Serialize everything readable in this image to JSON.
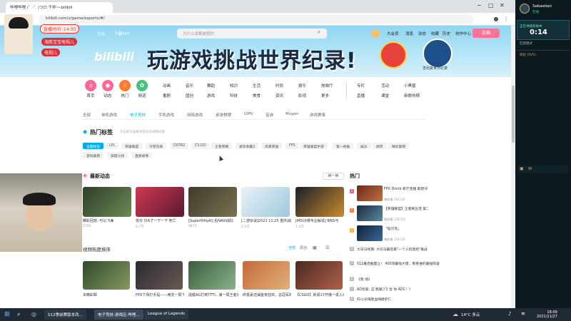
{
  "browser": {
    "tabs": [
      "哔哩哔哩 (゜-゜)つロ 干杯~-bilibili"
    ],
    "url": "bilibili.com/v/game/esports/#/"
  },
  "header": {
    "nav": [
      "主站",
      "番剧",
      "游戏中心",
      "直播",
      "会员购",
      "漫画",
      "赛事",
      "下载APP"
    ],
    "search_placeholder": "为什么说都是假的",
    "right_links": [
      "大会员",
      "消息",
      "动态",
      "收藏",
      "历史",
      "创作中心"
    ],
    "upload": "投稿"
  },
  "banner": {
    "title": "玩游戏挑战世界纪录!",
    "badge_label": "吉尼斯世界纪录"
  },
  "categories": [
    {
      "label": "首页",
      "color": "#ff6699"
    },
    {
      "label": "动态",
      "color": "#ff6699"
    },
    {
      "label": "热门",
      "color": "#ff7a2f"
    },
    {
      "label": "频道",
      "color": "#42c37c"
    }
  ],
  "subnav": [
    [
      "动画",
      "音乐",
      "舞蹈",
      "知识",
      "生活",
      "时尚",
      "娱乐",
      "放映厅"
    ],
    [
      "番剧",
      "国创",
      "游戏",
      "科技",
      "美食",
      "资讯",
      "影视",
      "更多"
    ]
  ],
  "extras": [
    "专栏",
    "活动",
    "小黑屋",
    "直播",
    "课堂",
    "新歌热榜"
  ],
  "subtabs": [
    "全部",
    "单机游戏",
    "电子竞技",
    "手机游戏",
    "网络游戏",
    "桌游棋牌",
    "GMV",
    "音游",
    "Mugen",
    "游戏赛事"
  ],
  "hot_tags": {
    "title": "热门标签",
    "subtitle": "点击即可查看本区标签视频内容",
    "tags": [
      "全部标签",
      "LPL",
      "英雄联盟",
      "守望先锋",
      "DOTA2",
      "CS:GO",
      "王者荣耀",
      "星际争霸2",
      "风暴英雄",
      "FPS",
      "英雄联盟手游",
      "第一视角",
      "娱乐",
      "搞笑",
      "精彩集锦",
      "游戏集锦",
      "穿越火线",
      "直播录像"
    ]
  },
  "dynamic": {
    "title": "最新动态",
    "refresh": "换一换"
  },
  "videos": [
    {
      "title": "精彩回放: 可以飞兼",
      "views": "1792"
    },
    {
      "title": "低价 只A了一下一下 死亡",
      "views": "6.7万"
    },
    {
      "title": "[SuperHifiyAI] 后NAVI战队",
      "views": "9475"
    },
    {
      "title": "[二游杂谈]2021 11.25 重庆战队",
      "views": "1.5万"
    },
    {
      "title": "[MSI决赛专业解说] RNG与",
      "views": "1.4万"
    }
  ],
  "ranking": {
    "title": "视频热度排序",
    "filters": [
      "全部",
      "原创"
    ]
  },
  "videos2": [
    {
      "title": "本精彩瞬"
    },
    {
      "title": "FPX下场打手是——两支一局\"统一局\""
    },
    {
      "title": "成都AG打到TTTI…第一局王者对抗"
    },
    {
      "title": "终极豪迈抽金夜狂欢，总冠军的最强阵容卡"
    },
    {
      "title": "【CSGO】新闻17开播一发入魂"
    }
  ],
  "hot": {
    "title": "热门",
    "items": [
      {
        "title": "FPX Doinb 新厅连播 斯嗯仔老乐乐 搞笑单一起瞎玩",
        "meta": "播放量 192.6万"
      },
      {
        "title": "【英雄联盟】王者刷五连 第二季收播回顾",
        "meta": "播放量 126.5万"
      },
      {
        "title": "「耻贝克」",
        "meta": "播放量 114.6万"
      }
    ],
    "list": [
      "大司马经典: 大司马最后暴\"一个人的连招\"再战",
      "S11最佳截图之！ 400场最强大佬，看看谁的最强阵容",
      "《我 他》",
      "AD玩家: 这 我输了3 合 你 ADC！？",
      "IG小乐嗨放血嗨摸虾仁"
    ]
  },
  "right_panel": {
    "name": "Sebastian",
    "status": "在线",
    "timer_label": "正在寻找对局中",
    "timer": "0:14",
    "queue": "匹配模式",
    "mode": "排位 (5V5)"
  },
  "overlay": {
    "time_label": "直播时间: 14:00",
    "line1": "海底宝宝电视儿",
    "line2": "电视儿"
  },
  "taskbar": {
    "apps": [
      "S12季前赛版本改...",
      "电子竞技-游戏区-哔哩...",
      "League of Legends"
    ],
    "weather": "14°C 多云",
    "time": "18:09",
    "date": "2021/11/27"
  }
}
